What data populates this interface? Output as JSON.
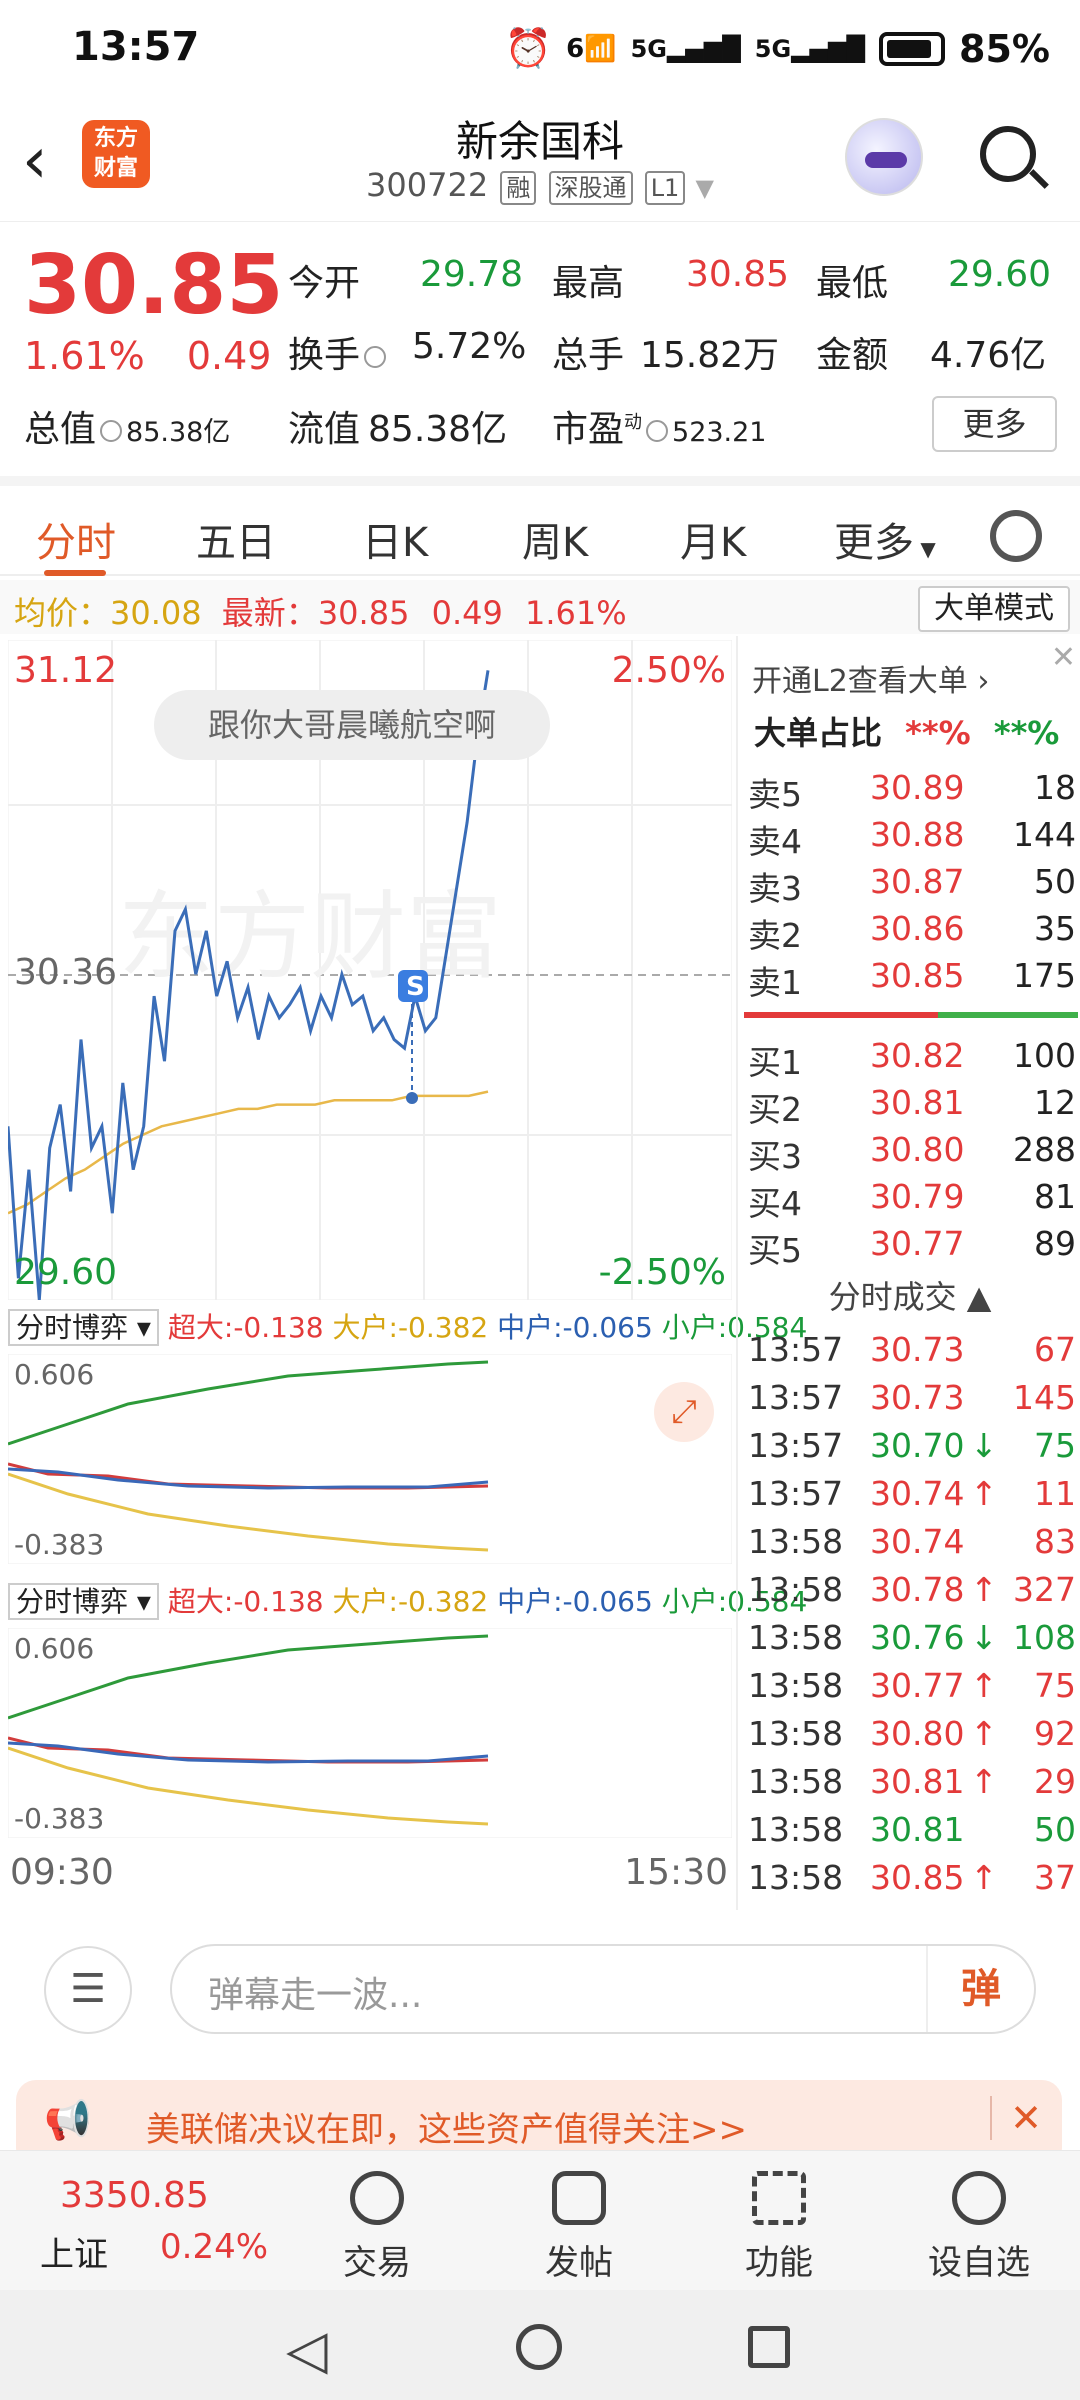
{
  "status_bar": {
    "time": "13:57",
    "net1": "6",
    "net2": "5G",
    "net3": "5G",
    "battery": "85%"
  },
  "header": {
    "logo_line1": "东方",
    "logo_line2": "财富",
    "title": "新余国科",
    "code": "300722",
    "tag_margin": "融",
    "tag_connect": "深股通",
    "tag_level": "L1"
  },
  "quote": {
    "price": "30.85",
    "change_pct": "1.61%",
    "change_amt": "0.49",
    "open_label": "今开",
    "open": "29.78",
    "high_label": "最高",
    "high": "30.85",
    "low_label": "最低",
    "low": "29.60",
    "turnover_label": "换手",
    "turnover": "5.72%",
    "volume_label": "总手",
    "volume": "15.82万",
    "amount_label": "金额",
    "amount": "4.76亿",
    "mktcap_label": "总值",
    "mktcap": "85.38亿",
    "float_label": "流值",
    "float": "85.38亿",
    "pe_label": "市盈",
    "pe_sup": "动",
    "pe": "523.21",
    "more_label": "更多"
  },
  "tabs": [
    {
      "label": "分时",
      "active": true
    },
    {
      "label": "五日"
    },
    {
      "label": "日K"
    },
    {
      "label": "周K"
    },
    {
      "label": "月K"
    },
    {
      "label": "更多"
    }
  ],
  "infoline": {
    "avg_label": "均价：",
    "avg": "30.08",
    "latest_label": "最新：",
    "latest": "30.85",
    "chg": "0.49",
    "pct": "1.61%",
    "mode_btn": "大单模式"
  },
  "chart": {
    "ymax": "31.12",
    "ymax_pct": "2.50%",
    "ymid": "30.36",
    "ymin": "29.60",
    "ymin_pct": "-2.50%",
    "bubble": "跟你大哥晨曦航空啊",
    "watermark": "东方财富",
    "marker": "S",
    "time_start": "09:30",
    "time_end": "15:30"
  },
  "chart_data": {
    "type": "line",
    "title": "",
    "ylim": [
      29.6,
      31.12
    ],
    "ref_price": 30.36,
    "series": [
      {
        "values": [
          30.0,
          29.65,
          29.9,
          29.6,
          29.95,
          30.05,
          29.85,
          30.2,
          29.95,
          30.0,
          29.8,
          30.1,
          29.9,
          30.0,
          30.3,
          30.15,
          30.45,
          30.5,
          30.35,
          30.45,
          30.3,
          30.38,
          30.25,
          30.32,
          30.2,
          30.3,
          30.25,
          30.28,
          30.32,
          30.22,
          30.3,
          30.25,
          30.35,
          30.28,
          30.3,
          30.22,
          30.25,
          30.2,
          30.18,
          30.3,
          30.22,
          30.25,
          30.4,
          30.55,
          30.7,
          30.9,
          31.05
        ]
      },
      {
        "values": [
          29.8,
          29.82,
          29.85,
          29.88,
          29.9,
          29.93,
          29.96,
          29.98,
          30.0,
          30.01,
          30.02,
          30.03,
          30.04,
          30.04,
          30.05,
          30.05,
          30.05,
          30.06,
          30.06,
          30.06,
          30.06,
          30.07,
          30.07,
          30.07,
          30.07,
          30.08
        ]
      }
    ]
  },
  "panels": [
    {
      "name": "分时博弈",
      "super_label": "超大:",
      "super": "-0.138",
      "big_label": "大户:",
      "big": "-0.382",
      "mid_label": "中户:",
      "mid": "-0.065",
      "small_label": "小户:",
      "small": "0.584",
      "ymax": "0.606",
      "ymin": "-0.383"
    },
    {
      "name": "分时博弈",
      "super_label": "超大:",
      "super": "-0.138",
      "big_label": "大户:",
      "big": "-0.382",
      "mid_label": "中户:",
      "mid": "-0.065",
      "small_label": "小户:",
      "small": "0.584",
      "ymax": "0.606",
      "ymin": "-0.383"
    }
  ],
  "rightpanel": {
    "l2_link": "开通L2查看大单",
    "ratio_label": "大单占比",
    "ratio_buy": "**%",
    "ratio_sell": "**%",
    "asks": [
      {
        "label": "卖5",
        "price": "30.89",
        "vol": "18"
      },
      {
        "label": "卖4",
        "price": "30.88",
        "vol": "144"
      },
      {
        "label": "卖3",
        "price": "30.87",
        "vol": "50"
      },
      {
        "label": "卖2",
        "price": "30.86",
        "vol": "35"
      },
      {
        "label": "卖1",
        "price": "30.85",
        "vol": "175"
      }
    ],
    "bids": [
      {
        "label": "买1",
        "price": "30.82",
        "vol": "100"
      },
      {
        "label": "买2",
        "price": "30.81",
        "vol": "12"
      },
      {
        "label": "买3",
        "price": "30.80",
        "vol": "288"
      },
      {
        "label": "买4",
        "price": "30.79",
        "vol": "81"
      },
      {
        "label": "买5",
        "price": "30.77",
        "vol": "89"
      }
    ],
    "trades_title": "分时成交",
    "trades": [
      {
        "time": "13:57",
        "price": "30.73",
        "arrow": "",
        "vol": "67",
        "dir": "red"
      },
      {
        "time": "13:57",
        "price": "30.73",
        "arrow": "",
        "vol": "145",
        "dir": "red"
      },
      {
        "time": "13:57",
        "price": "30.70",
        "arrow": "↓",
        "vol": "75",
        "dir": "green"
      },
      {
        "time": "13:57",
        "price": "30.74",
        "arrow": "↑",
        "vol": "11",
        "dir": "red"
      },
      {
        "time": "13:58",
        "price": "30.74",
        "arrow": "",
        "vol": "83",
        "dir": "red"
      },
      {
        "time": "13:58",
        "price": "30.78",
        "arrow": "↑",
        "vol": "327",
        "dir": "red"
      },
      {
        "time": "13:58",
        "price": "30.76",
        "arrow": "↓",
        "vol": "108",
        "dir": "green"
      },
      {
        "time": "13:58",
        "price": "30.77",
        "arrow": "↑",
        "vol": "75",
        "dir": "red"
      },
      {
        "time": "13:58",
        "price": "30.80",
        "arrow": "↑",
        "vol": "92",
        "dir": "red"
      },
      {
        "time": "13:58",
        "price": "30.81",
        "arrow": "↑",
        "vol": "29",
        "dir": "red"
      },
      {
        "time": "13:58",
        "price": "30.81",
        "arrow": "",
        "vol": "50",
        "dir": "green"
      },
      {
        "time": "13:58",
        "price": "30.85",
        "arrow": "↑",
        "vol": "37",
        "dir": "red"
      }
    ]
  },
  "danmaku": {
    "placeholder": "弹幕走一波...",
    "send": "弹"
  },
  "news": {
    "text": "美联储决议在即，这些资产值得关注>>"
  },
  "bottomnav": {
    "index_value": "3350.85",
    "index_name": "上证",
    "index_pct": "0.24%",
    "items": [
      "交易",
      "发帖",
      "功能",
      "设自选"
    ]
  },
  "colors": {
    "red": "#e33a3a",
    "green": "#1a9a3a",
    "blue": "#2b5fb0",
    "yellow": "#d6a512",
    "accent": "#e05a28"
  }
}
